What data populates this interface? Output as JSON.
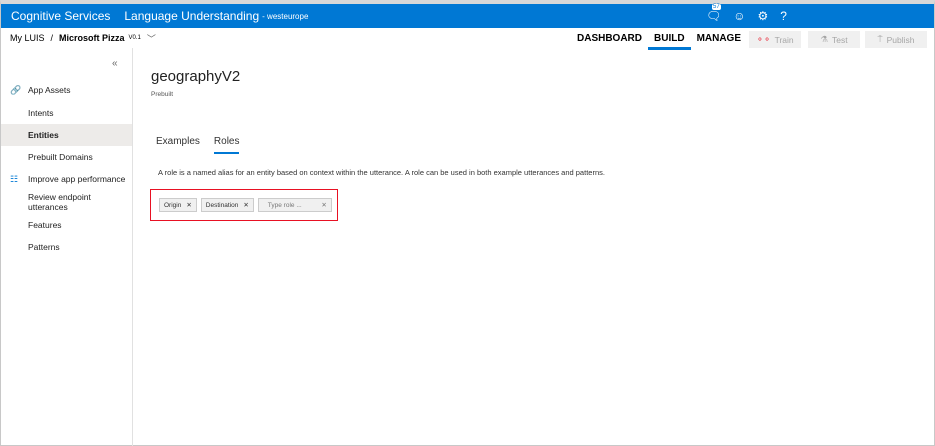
{
  "header": {
    "brand": "Cognitive Services",
    "product": "Language Understanding",
    "region": "- westeurope",
    "notification_count": "57"
  },
  "breadcrumb": {
    "root": "My LUIS",
    "separator": "/",
    "app": "Microsoft Pizza",
    "version": "V0.1"
  },
  "nav": {
    "tabs": [
      "DASHBOARD",
      "BUILD",
      "MANAGE"
    ],
    "active": "BUILD"
  },
  "actions": {
    "train": "Train",
    "test": "Test",
    "publish": "Publish"
  },
  "sidebar": {
    "items": [
      {
        "label": "App Assets"
      },
      {
        "label": "Intents"
      },
      {
        "label": "Entities"
      },
      {
        "label": "Prebuilt Domains"
      },
      {
        "label": "Improve app performance"
      },
      {
        "label": "Review endpoint utterances"
      },
      {
        "label": "Features"
      },
      {
        "label": "Patterns"
      }
    ]
  },
  "entity": {
    "name": "geographyV2",
    "type": "Prebuilt"
  },
  "tabs": [
    "Examples",
    "Roles"
  ],
  "roles": {
    "description": "A role is a named alias for an entity based on context within the utterance. A role can be used in both example utterances and patterns.",
    "tags": [
      "Origin",
      "Destination"
    ],
    "placeholder": "Type role ..."
  }
}
